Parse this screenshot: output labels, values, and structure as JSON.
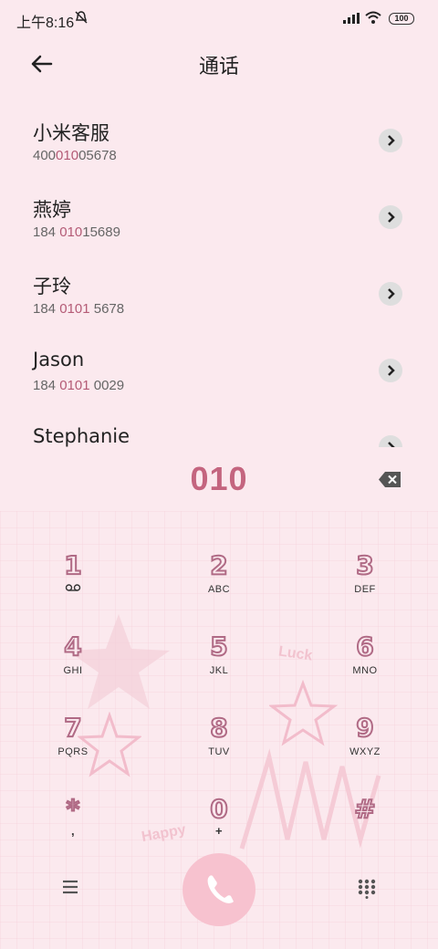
{
  "status": {
    "time": "上午8:16",
    "battery": "100"
  },
  "header": {
    "title": "通话"
  },
  "contacts": [
    {
      "name": "小米客服",
      "pre": "400",
      "hl": "010",
      "post": "05678"
    },
    {
      "name": "燕婷",
      "pre": "184 ",
      "hl": "010",
      "post": "15689"
    },
    {
      "name": "子玲",
      "pre": "184 ",
      "hl": "0101",
      "post": " 5678"
    },
    {
      "name": "Jason",
      "pre": "184 ",
      "hl": "0101",
      "post": " 0029"
    },
    {
      "name": "Stephanie",
      "pre": "",
      "hl": "",
      "post": ""
    }
  ],
  "dial": {
    "digits": "010"
  },
  "keypad": [
    {
      "digit": "1",
      "letters": "voicemail-icon"
    },
    {
      "digit": "2",
      "letters": "ABC"
    },
    {
      "digit": "3",
      "letters": "DEF"
    },
    {
      "digit": "4",
      "letters": "GHI"
    },
    {
      "digit": "5",
      "letters": "JKL"
    },
    {
      "digit": "6",
      "letters": "MNO"
    },
    {
      "digit": "7",
      "letters": "PQRS"
    },
    {
      "digit": "8",
      "letters": "TUV"
    },
    {
      "digit": "9",
      "letters": "WXYZ"
    },
    {
      "digit": "*",
      "letters": ","
    },
    {
      "digit": "0",
      "letters": "+"
    },
    {
      "digit": "#",
      "letters": ""
    }
  ],
  "decor": {
    "luck": "Luck",
    "happy": "Happy"
  },
  "colors": {
    "accent": "#c4657f",
    "call": "#f7c2cf",
    "background": "#fbe9ee"
  }
}
